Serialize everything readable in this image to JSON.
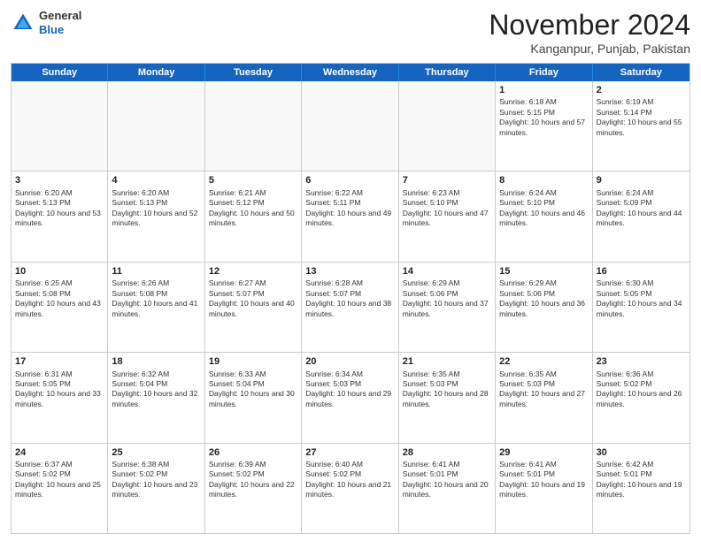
{
  "header": {
    "logo_general": "General",
    "logo_blue": "Blue",
    "month_title": "November 2024",
    "location": "Kanganpur, Punjab, Pakistan"
  },
  "days_of_week": [
    "Sunday",
    "Monday",
    "Tuesday",
    "Wednesday",
    "Thursday",
    "Friday",
    "Saturday"
  ],
  "weeks": [
    {
      "cells": [
        {
          "day": "",
          "empty": true
        },
        {
          "day": "",
          "empty": true
        },
        {
          "day": "",
          "empty": true
        },
        {
          "day": "",
          "empty": true
        },
        {
          "day": "",
          "empty": true
        },
        {
          "day": "1",
          "sunrise": "6:18 AM",
          "sunset": "5:15 PM",
          "daylight": "10 hours and 57 minutes."
        },
        {
          "day": "2",
          "sunrise": "6:19 AM",
          "sunset": "5:14 PM",
          "daylight": "10 hours and 55 minutes."
        }
      ]
    },
    {
      "cells": [
        {
          "day": "3",
          "sunrise": "6:20 AM",
          "sunset": "5:13 PM",
          "daylight": "10 hours and 53 minutes."
        },
        {
          "day": "4",
          "sunrise": "6:20 AM",
          "sunset": "5:13 PM",
          "daylight": "10 hours and 52 minutes."
        },
        {
          "day": "5",
          "sunrise": "6:21 AM",
          "sunset": "5:12 PM",
          "daylight": "10 hours and 50 minutes."
        },
        {
          "day": "6",
          "sunrise": "6:22 AM",
          "sunset": "5:11 PM",
          "daylight": "10 hours and 49 minutes."
        },
        {
          "day": "7",
          "sunrise": "6:23 AM",
          "sunset": "5:10 PM",
          "daylight": "10 hours and 47 minutes."
        },
        {
          "day": "8",
          "sunrise": "6:24 AM",
          "sunset": "5:10 PM",
          "daylight": "10 hours and 46 minutes."
        },
        {
          "day": "9",
          "sunrise": "6:24 AM",
          "sunset": "5:09 PM",
          "daylight": "10 hours and 44 minutes."
        }
      ]
    },
    {
      "cells": [
        {
          "day": "10",
          "sunrise": "6:25 AM",
          "sunset": "5:08 PM",
          "daylight": "10 hours and 43 minutes."
        },
        {
          "day": "11",
          "sunrise": "6:26 AM",
          "sunset": "5:08 PM",
          "daylight": "10 hours and 41 minutes."
        },
        {
          "day": "12",
          "sunrise": "6:27 AM",
          "sunset": "5:07 PM",
          "daylight": "10 hours and 40 minutes."
        },
        {
          "day": "13",
          "sunrise": "6:28 AM",
          "sunset": "5:07 PM",
          "daylight": "10 hours and 38 minutes."
        },
        {
          "day": "14",
          "sunrise": "6:29 AM",
          "sunset": "5:06 PM",
          "daylight": "10 hours and 37 minutes."
        },
        {
          "day": "15",
          "sunrise": "6:29 AM",
          "sunset": "5:06 PM",
          "daylight": "10 hours and 36 minutes."
        },
        {
          "day": "16",
          "sunrise": "6:30 AM",
          "sunset": "5:05 PM",
          "daylight": "10 hours and 34 minutes."
        }
      ]
    },
    {
      "cells": [
        {
          "day": "17",
          "sunrise": "6:31 AM",
          "sunset": "5:05 PM",
          "daylight": "10 hours and 33 minutes."
        },
        {
          "day": "18",
          "sunrise": "6:32 AM",
          "sunset": "5:04 PM",
          "daylight": "10 hours and 32 minutes."
        },
        {
          "day": "19",
          "sunrise": "6:33 AM",
          "sunset": "5:04 PM",
          "daylight": "10 hours and 30 minutes."
        },
        {
          "day": "20",
          "sunrise": "6:34 AM",
          "sunset": "5:03 PM",
          "daylight": "10 hours and 29 minutes."
        },
        {
          "day": "21",
          "sunrise": "6:35 AM",
          "sunset": "5:03 PM",
          "daylight": "10 hours and 28 minutes."
        },
        {
          "day": "22",
          "sunrise": "6:35 AM",
          "sunset": "5:03 PM",
          "daylight": "10 hours and 27 minutes."
        },
        {
          "day": "23",
          "sunrise": "6:36 AM",
          "sunset": "5:02 PM",
          "daylight": "10 hours and 26 minutes."
        }
      ]
    },
    {
      "cells": [
        {
          "day": "24",
          "sunrise": "6:37 AM",
          "sunset": "5:02 PM",
          "daylight": "10 hours and 25 minutes."
        },
        {
          "day": "25",
          "sunrise": "6:38 AM",
          "sunset": "5:02 PM",
          "daylight": "10 hours and 23 minutes."
        },
        {
          "day": "26",
          "sunrise": "6:39 AM",
          "sunset": "5:02 PM",
          "daylight": "10 hours and 22 minutes."
        },
        {
          "day": "27",
          "sunrise": "6:40 AM",
          "sunset": "5:02 PM",
          "daylight": "10 hours and 21 minutes."
        },
        {
          "day": "28",
          "sunrise": "6:41 AM",
          "sunset": "5:01 PM",
          "daylight": "10 hours and 20 minutes."
        },
        {
          "day": "29",
          "sunrise": "6:41 AM",
          "sunset": "5:01 PM",
          "daylight": "10 hours and 19 minutes."
        },
        {
          "day": "30",
          "sunrise": "6:42 AM",
          "sunset": "5:01 PM",
          "daylight": "10 hours and 19 minutes."
        }
      ]
    }
  ]
}
